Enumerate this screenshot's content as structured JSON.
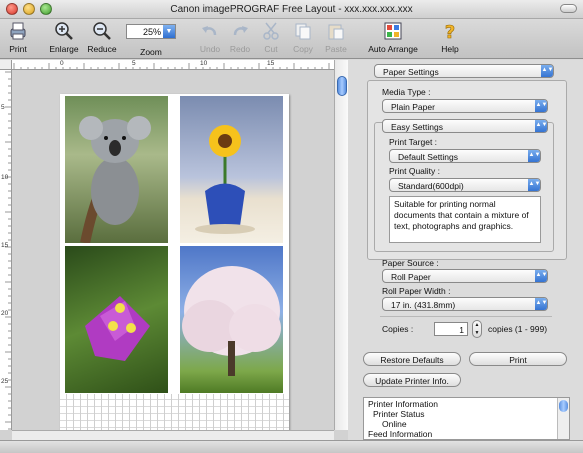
{
  "window": {
    "title": "Canon imagePROGRAF Free Layout - xxx.xxx.xxx.xxx"
  },
  "toolbar": {
    "print": "Print",
    "enlarge": "Enlarge",
    "reduce": "Reduce",
    "zoom_value": "25%",
    "zoom_label": "Zoom",
    "undo": "Undo",
    "redo": "Redo",
    "cut": "Cut",
    "copy": "Copy",
    "paste": "Paste",
    "auto_arrange": "Auto Arrange",
    "help": "Help"
  },
  "ruler": {
    "top": [
      "0",
      "5",
      "10",
      "15"
    ],
    "left": [
      "5",
      "10",
      "15",
      "20",
      "25"
    ]
  },
  "settings": {
    "panel_select": "Paper Settings",
    "media_type_label": "Media Type :",
    "media_type_value": "Plain Paper",
    "mode_select": "Easy Settings",
    "print_target_label": "Print Target :",
    "print_target_value": "Default Settings",
    "print_quality_label": "Print Quality :",
    "print_quality_value": "Standard(600dpi)",
    "description": "Suitable for printing normal documents that contain a mixture of text, photographs and graphics.",
    "paper_source_label": "Paper Source :",
    "paper_source_value": "Roll Paper",
    "roll_width_label": "Roll Paper Width :",
    "roll_width_value": "17 in. (431.8mm)",
    "copies_label": "Copies :",
    "copies_value": "1",
    "copies_range": "copies (1 - 999)"
  },
  "buttons": {
    "restore_defaults": "Restore Defaults",
    "print": "Print",
    "update_printer_info": "Update Printer Info."
  },
  "printer_info": [
    "Printer Information",
    "Printer Status",
    "Online",
    "Feed Information"
  ]
}
